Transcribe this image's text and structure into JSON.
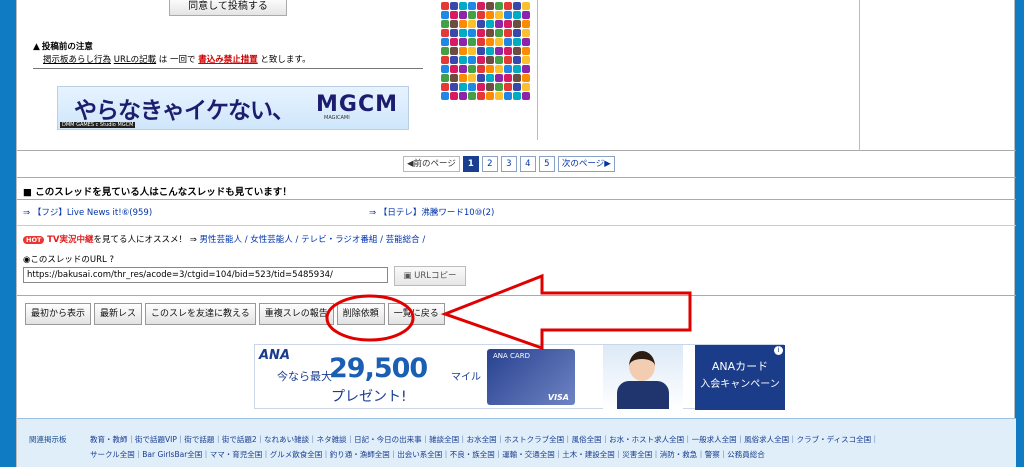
{
  "top": {
    "agree_button": "同意して投稿する",
    "notice_title": "投稿前の注意",
    "notice_part1": "掲示板あらし行為",
    "notice_part2": "URLの記載",
    "notice_part3": "は 一回で",
    "notice_part4": "書込み禁止措置",
    "notice_part5": "と致します。"
  },
  "ad": {
    "headline": "やらなきゃイケない、",
    "logo": "MGCM",
    "logo_sub": "MAGICAMI",
    "credit": "DMM GAMES c Studio MGCM"
  },
  "pager": {
    "prev": "前のページ",
    "pages": [
      "1",
      "2",
      "3",
      "4",
      "5"
    ],
    "next": "次のページ"
  },
  "related": {
    "heading": "このスレッドを見ている人はこんなスレッドも見ています！",
    "link1": "⇒ 【フジ】Live News it!⑥(959)",
    "link2": "⇒ 【日テレ】沸騰ワード10⑩(2)"
  },
  "tv": {
    "badge": "HOT",
    "lead": "TV実況中継",
    "mid": "を見てる人にオススメ！ ⇒",
    "links": "男性芸能人 / 女性芸能人 / テレビ・ラジオ番組 / 芸能総合 /"
  },
  "url": {
    "label": "このスレッドのURL",
    "value": "https://bakusai.com/thr_res/acode=3/ctgid=104/bid=523/tid=5485934/",
    "copy_button": "URLコピー"
  },
  "actions": [
    "最初から表示",
    "最新レス",
    "このスレを友達に教える",
    "重複スレの報告",
    "削除依頼",
    "一覧に戻る"
  ],
  "ana": {
    "logo": "ANA",
    "now": "今なら最大",
    "amount": "29,500",
    "unit": "マイル",
    "present": "プレゼント!",
    "card_text": "ANA CARD",
    "card_brand": "VISA",
    "right_line1": "ANAカード",
    "right_line2": "入会キャンペーン"
  },
  "footer": {
    "label": "関連掲示板",
    "line1": "教育・教師｜街で話題VIP｜街で話題｜街で話題2｜なれあい雑談｜ネタ雑談｜日記・今日の出来事｜雑談全国｜お水全国｜ホストクラブ全国｜風俗全国｜お水・ホスト求人全国｜一般求人全国｜風俗求人全国｜クラブ・ディスコ全国｜",
    "line2": "サークル全国｜Bar GirlsBar全国｜ママ・育児全国｜グルメ飲食全国｜釣り通・漁師全国｜出会い系全国｜不良・族全国｜運輸・交通全国｜土木・建設全国｜災害全国｜消防・救急｜警察｜公務員総合"
  },
  "colors": {
    "accent_blue": "#0f7bc2",
    "annotation_red": "#e00000"
  }
}
